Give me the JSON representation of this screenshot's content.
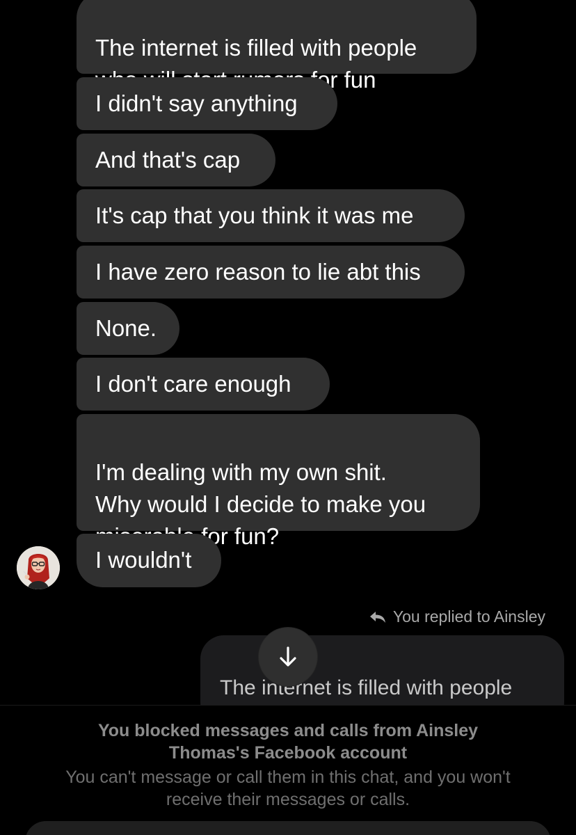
{
  "messages": [
    {
      "text": "The internet is filled with people\nwho will start rumors for fun"
    },
    {
      "text": "I didn't say anything"
    },
    {
      "text": "And that's cap"
    },
    {
      "text": "It's cap that you think it was me"
    },
    {
      "text": "I have zero reason to lie abt this"
    },
    {
      "text": "None."
    },
    {
      "text": "I don't care enough"
    },
    {
      "text": "I'm dealing with my own shit.\nWhy would I decide to make you\nmiserable for fun?"
    },
    {
      "text": "I wouldn't"
    }
  ],
  "reply": {
    "label": "You replied to Ainsley",
    "quoted_text": "The internet is filled with people\nwho will start rumors for fun"
  },
  "blocked_notice": {
    "title": "You blocked messages and calls from Ainsley Thomas's Facebook account",
    "subtitle": "You can't message or call them in this chat, and you won't receive their messages or calls."
  },
  "icons": {
    "reply": "reply-arrow-icon",
    "scroll": "arrow-down-icon",
    "avatar": "contact-avatar"
  },
  "colors": {
    "background": "#000000",
    "incoming_bubble": "#303030",
    "quoted_bubble": "#1c1c1e",
    "muted_text": "#a9a9a9"
  }
}
